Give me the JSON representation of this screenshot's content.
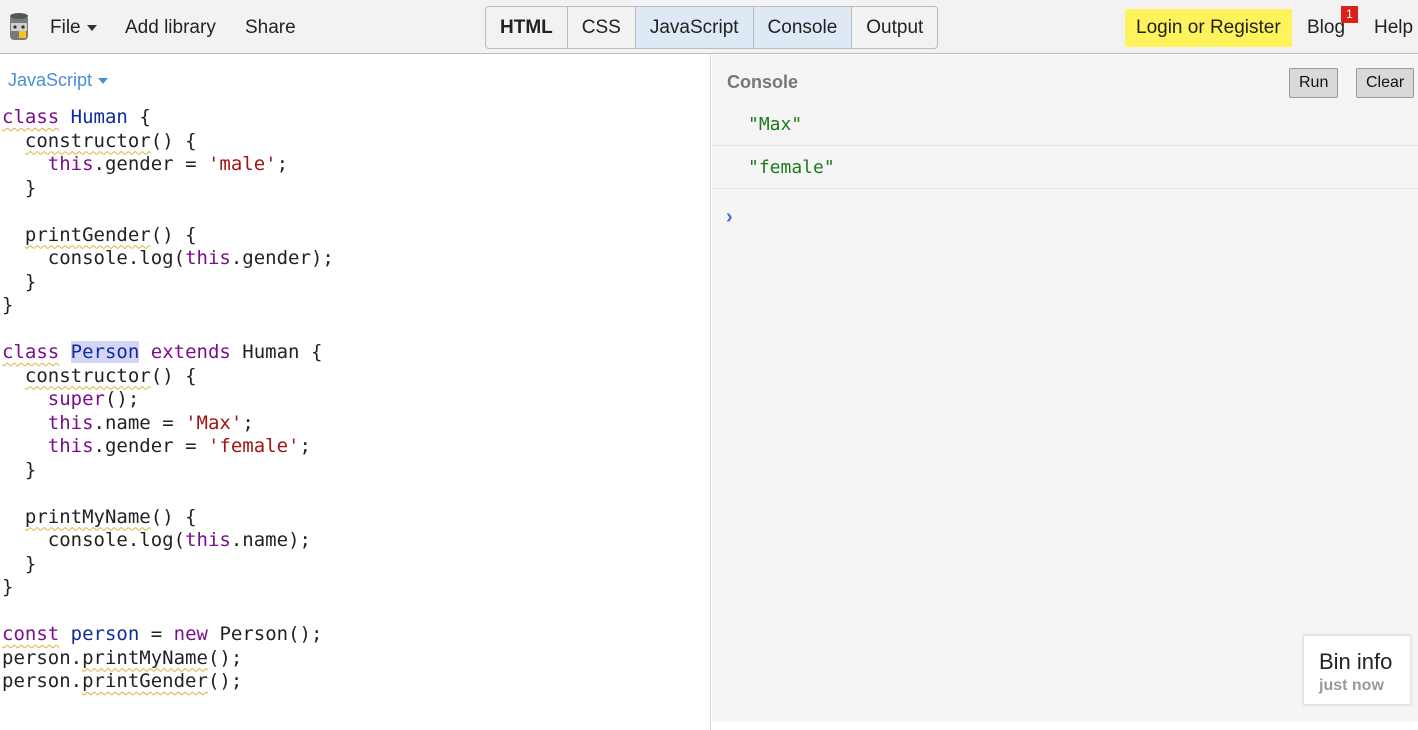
{
  "colors": {
    "topbar_bg": "#f2f2f2",
    "login_bg": "#fff35c",
    "active_tab_bg": "#dfe9f5",
    "badge_bg": "#d9221a",
    "console_string": "#1c7a1c",
    "lang_link": "#4a8fd6"
  },
  "topbar": {
    "logo_icon": "jsbin-logo-icon",
    "file_label": "File",
    "add_library_label": "Add library",
    "share_label": "Share",
    "panels": [
      "HTML",
      "CSS",
      "JavaScript",
      "Console",
      "Output"
    ],
    "active_panels": [
      "JavaScript",
      "Console"
    ],
    "login_label": "Login or Register",
    "blog_label": "Blog",
    "blog_badge": "1",
    "help_label": "Help"
  },
  "editor": {
    "language_label": "JavaScript",
    "code_lines": [
      "class Human {",
      "  constructor() {",
      "    this.gender = 'male';",
      "  }",
      "",
      "  printGender() {",
      "    console.log(this.gender);",
      "  }",
      "}",
      "",
      "class Person extends Human {",
      "  constructor() {",
      "    super();",
      "    this.name = 'Max';",
      "    this.gender = 'female';",
      "  }",
      "",
      "  printMyName() {",
      "    console.log(this.name);",
      "  }",
      "}",
      "",
      "const person = new Person();",
      "person.printMyName();",
      "person.printGender();"
    ]
  },
  "console": {
    "title": "Console",
    "run_label": "Run",
    "clear_label": "Clear",
    "logs": [
      "\"Max\"",
      "\"female\""
    ],
    "prompt_icon": "chevron-right-icon"
  },
  "bin_info": {
    "title": "Bin info",
    "subtitle": "just now"
  }
}
